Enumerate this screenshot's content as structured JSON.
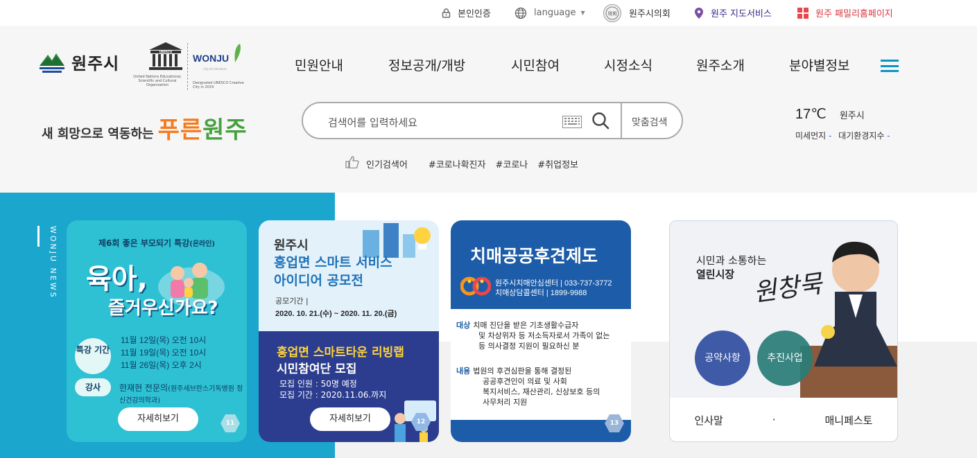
{
  "topbar": {
    "auth": "본인인증",
    "language": "language",
    "council": "원주시의회",
    "map": "원주 지도서비스",
    "family": "원주 패밀리홈페이지",
    "emblem_text": "의회"
  },
  "logo": {
    "text": "원주시"
  },
  "unesco": {
    "wordmark": "UNESCO",
    "small": "United Nations Educational, Scientific and Cultural Organization"
  },
  "wonju_city": {
    "wordmark": "WONJU",
    "tagline": "City of Literature",
    "small": "Designated UNESCO Creative City in 2019"
  },
  "slogan": {
    "part1": "새 희망으로 역동하는",
    "part2a": "푸른",
    "part2b": "원주"
  },
  "nav": [
    "민원안내",
    "정보공개/개방",
    "시민참여",
    "시정소식",
    "원주소개",
    "분야별정보"
  ],
  "search": {
    "placeholder": "검색어를 입력하세요",
    "custom": "맞춤검색"
  },
  "popular": {
    "label": "인기검색어",
    "tags": [
      "#코로나확진자",
      "#코로나",
      "#취업정보"
    ]
  },
  "weather": {
    "temp": "17℃",
    "location": "원주시",
    "dust_label": "미세먼지",
    "dust_value": "-",
    "aqi_label": "대기환경지수",
    "aqi_value": "-"
  },
  "news_label": "WONJU NEWS",
  "card1": {
    "title": "제6회 좋은 부모되기 특강",
    "title_sub": "(온라인)",
    "big1": "육아,",
    "big2": "즐거우신가요?",
    "period_label": "특강 기간",
    "dates": [
      "11월 12일(목) 오전 10시",
      "11월 19일(목) 오전 10시",
      "11월 26일(목) 오후 2시"
    ],
    "lecturer_label": "강사",
    "lecturer": "한재현 전문의",
    "lecturer_sub": "(원주세브란스기독병원 정신건강의학과)",
    "button": "자세히보기",
    "num": "11"
  },
  "card2": {
    "city": "원주시",
    "title1": "흥업면 스마트 서비스",
    "title2": "아이디어 공모전",
    "period_label": "공모기간 |",
    "period": "2020. 10. 21.(수) ~ 2020. 11. 20.(금)",
    "bottom1": "흥업면 스마트타운 리빙랩",
    "bottom2": "시민참여단 모집",
    "recruit": "모집 인원 : 50명 예정",
    "recruit_period": "모집 기간 : 2020.11.06.까지",
    "button": "자세히보기",
    "num": "12"
  },
  "card3": {
    "title": "치매공공후견제도",
    "phone1": "원주시치매안심센터 | 033-737-3772",
    "phone2": "치매상담콜센터 | 1899-9988",
    "target_label": "대상",
    "target": [
      "치매 진단을 받은 기초생활수급자",
      "및 차상위자 등 저소득자로서 가족이 없는",
      "등 의사결정 지원이 필요하신 분"
    ],
    "content_label": "내용",
    "content": [
      "법원의 후견심판을 통해 결정된",
      "공공후견인이 의료 및 사회",
      "복지서비스, 재산관리, 신상보호 등의",
      "사무처리 지원"
    ],
    "num": "13"
  },
  "card4": {
    "line1": "시민과 소통하는",
    "line2": "열린시장",
    "signature": "원창묵",
    "pledge": "공약사항",
    "project": "추진사업",
    "greeting": "인사말",
    "dot": "·",
    "manifesto": "매니페스토"
  },
  "colors": {
    "accent": "#1ba6ce",
    "navy": "#2c3d8f",
    "blue": "#1d5ca8",
    "orange": "#f47b20",
    "green": "#46a13e"
  }
}
